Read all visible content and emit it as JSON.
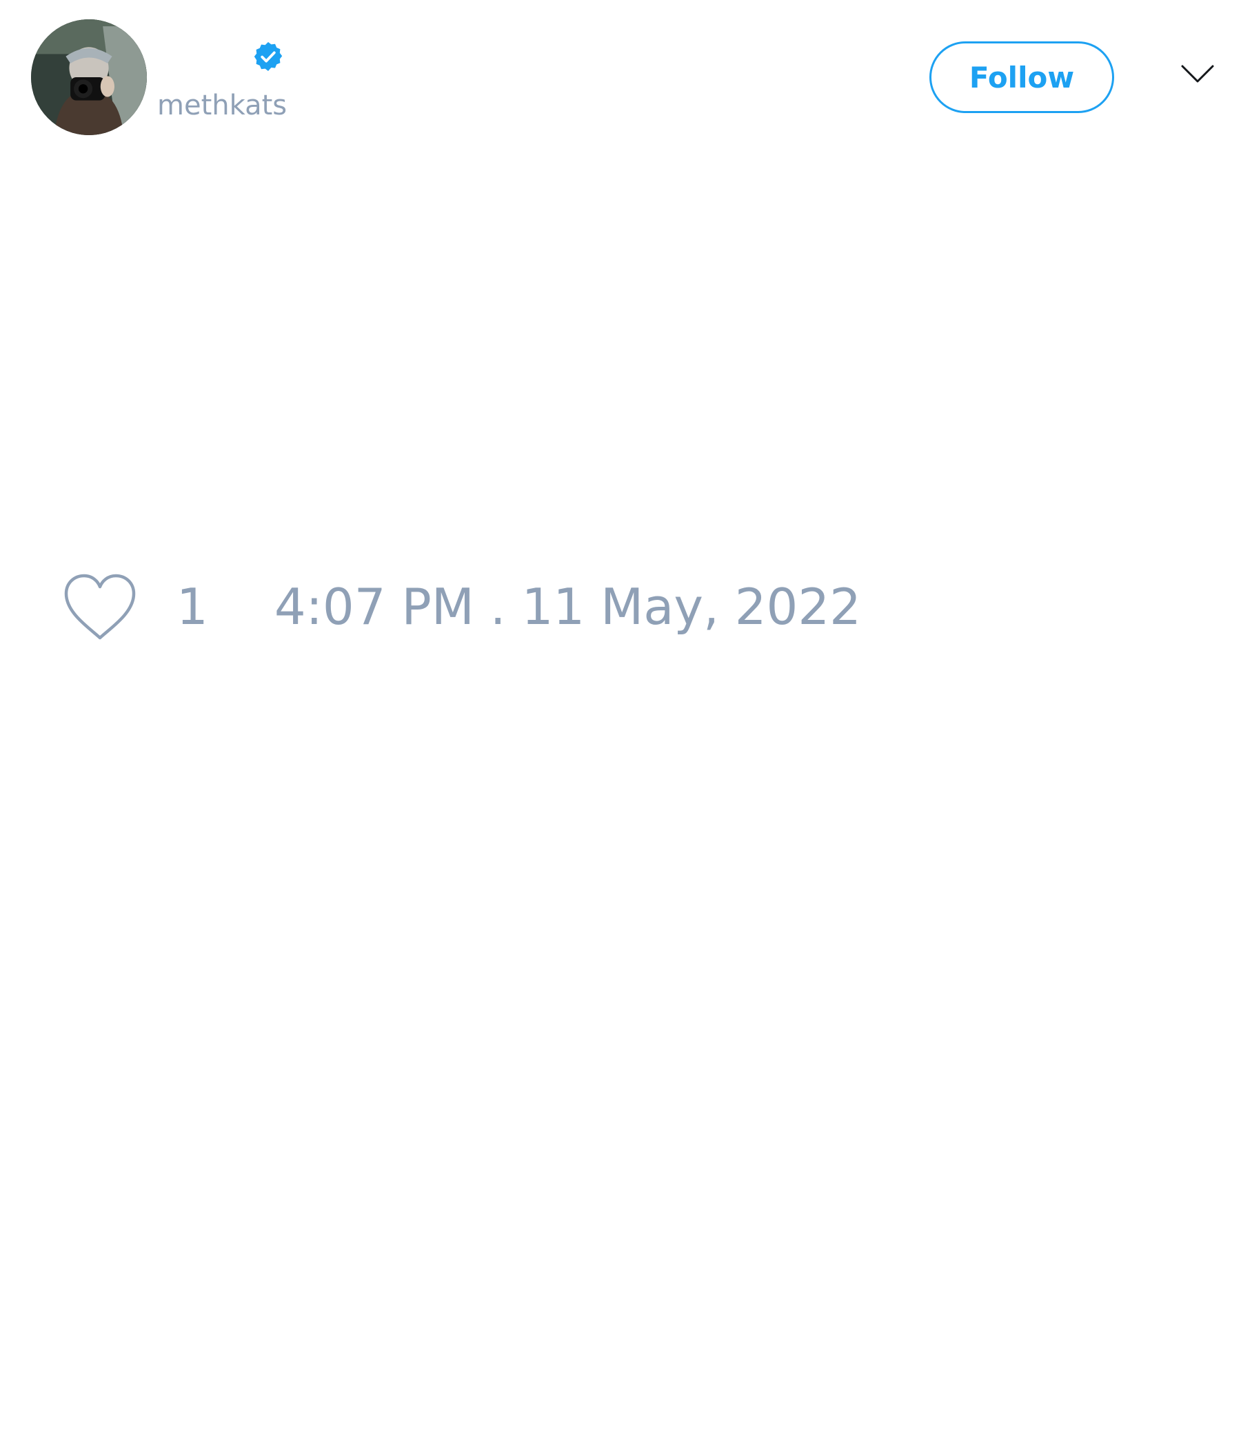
{
  "author": {
    "display_name": "",
    "handle": "methkats",
    "verified": true,
    "avatar_icon": "user-avatar-photo"
  },
  "actions": {
    "follow_label": "Follow",
    "menu_icon": "chevron-down-icon"
  },
  "footer": {
    "like_icon": "heart-outline-icon",
    "like_count": "1",
    "timestamp": "4:07 PM . 11 May, 2022"
  },
  "colors": {
    "accent": "#1da1f2",
    "muted_text": "#8fa0b6",
    "primary_text": "#14171a",
    "background": "#ffffff"
  }
}
